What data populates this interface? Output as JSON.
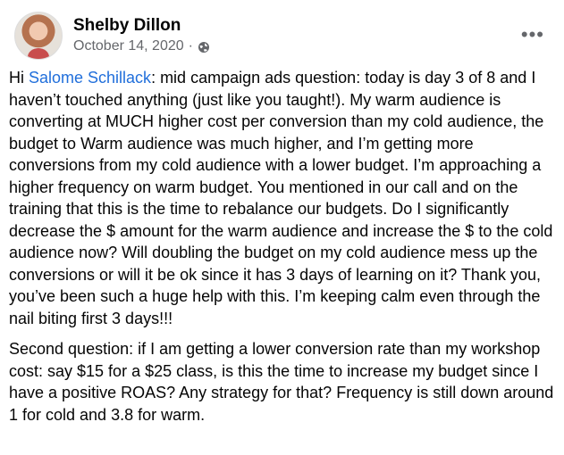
{
  "post": {
    "author": "Shelby Dillon",
    "date": "October 14, 2020",
    "separator": "·",
    "mention": "Salome Schillack",
    "greeting": "Hi ",
    "para1_after_mention": ": mid campaign ads question: today is day 3 of 8 and I haven’t touched anything (just like you taught!). My warm audience is converting at MUCH higher cost per conversion than my cold audience, the budget to Warm audience was much higher, and I’m getting more conversions from my cold audience with a lower budget. I’m approaching a higher frequency on warm budget. You mentioned in our call and on the training that this is the time to rebalance our budgets. Do I significantly decrease the $ amount for the warm audience and increase the $ to the cold audience now? Will doubling the budget on my cold audience mess up the conversions or will it be ok since it has 3 days of learning on it? Thank you, you’ve been such a huge help with this. I’m keeping calm even through the nail biting first 3 days!!!",
    "para2": "Second question: if I am getting a lower conversion rate than my workshop cost: say $15 for a $25 class, is this the time to increase my budget since I have a positive ROAS? Any strategy for that? Frequency is still down around 1 for cold and 3.8 for warm.",
    "more_label": "•••",
    "privacy_icon": "globe-icon",
    "menu_icon": "more-options-icon"
  }
}
